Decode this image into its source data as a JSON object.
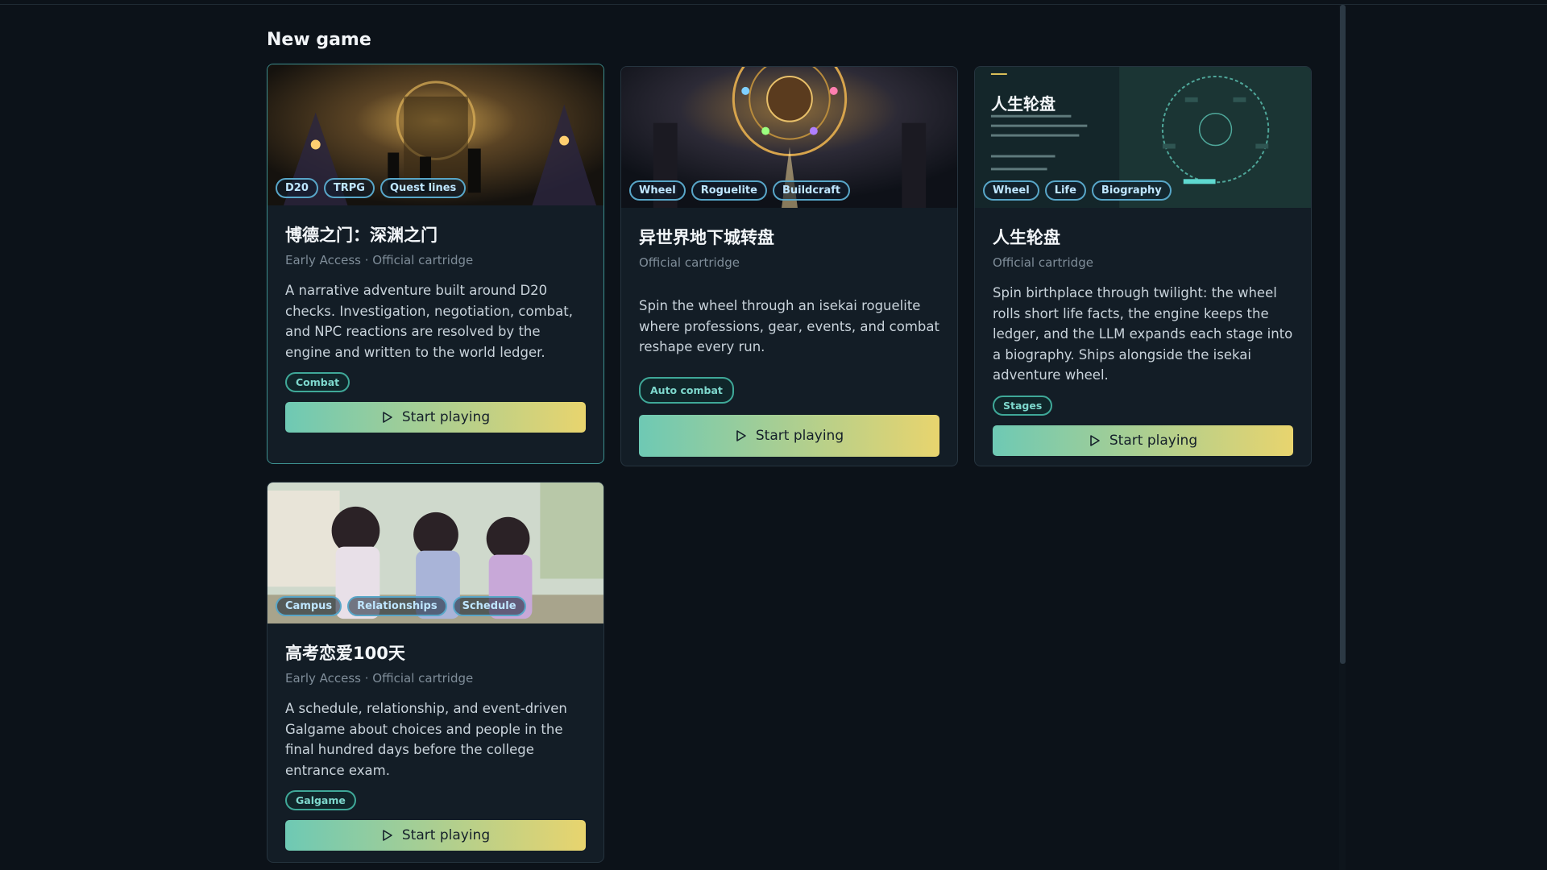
{
  "section": {
    "title": "New game"
  },
  "cards": [
    {
      "title": "博德之门：深渊之门",
      "meta": "Early Access · Official cartridge",
      "description": "A narrative adventure built around D20 checks. Investigation, negotiation, combat, and NPC reactions are resolved by the engine and written to the world ledger.",
      "overlay_tags": [
        "D20",
        "TRPG",
        "Quest lines"
      ],
      "genre_tag": "Combat",
      "button": "Start playing"
    },
    {
      "title": "异世界地下城转盘",
      "meta": "Official cartridge",
      "description": "Spin the wheel through an isekai roguelite where professions, gear, events, and combat reshape every run.",
      "overlay_tags": [
        "Wheel",
        "Roguelite",
        "Buildcraft"
      ],
      "genre_tag": "Auto combat",
      "button": "Start playing"
    },
    {
      "title": "人生轮盘",
      "meta": "Official cartridge",
      "description": "Spin birthplace through twilight: the wheel rolls short life facts, the engine keeps the ledger, and the LLM expands each stage into a biography. Ships alongside the isekai adventure wheel.",
      "overlay_tags": [
        "Wheel",
        "Life",
        "Biography"
      ],
      "genre_tag": "Stages",
      "button": "Start playing",
      "banner_title": "人生轮盘"
    },
    {
      "title": "高考恋爱100天",
      "meta": "Early Access · Official cartridge",
      "description": "A schedule, relationship, and event-driven Galgame about choices and people in the final hundred days before the college entrance exam.",
      "overlay_tags": [
        "Campus",
        "Relationships",
        "Schedule"
      ],
      "genre_tag": "Galgame",
      "button": "Start playing"
    }
  ],
  "icons": {
    "play": "play-icon"
  }
}
